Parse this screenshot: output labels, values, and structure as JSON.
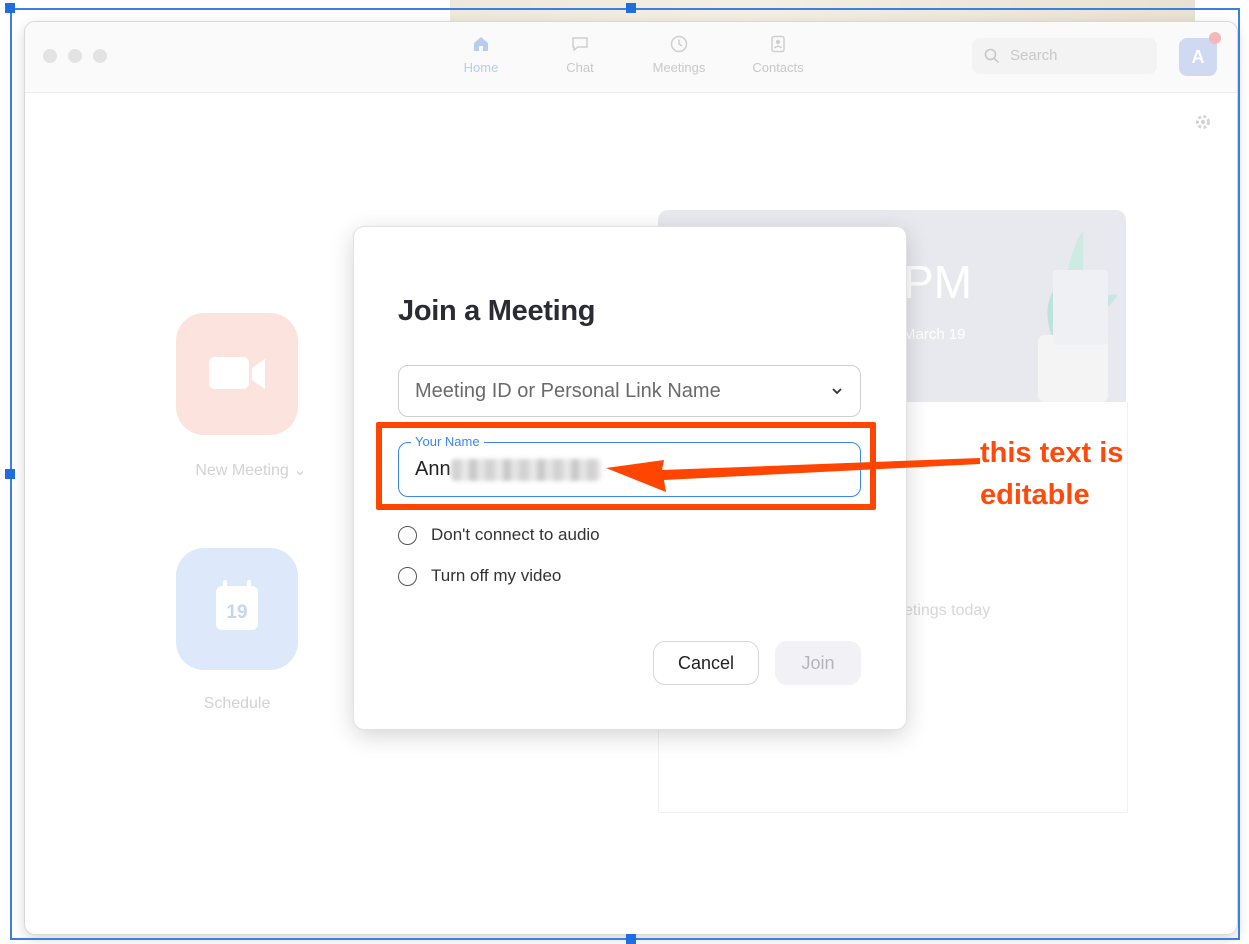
{
  "app": {
    "nav": [
      {
        "label": "Home",
        "icon": "home-icon",
        "active": true
      },
      {
        "label": "Chat",
        "icon": "chat-icon",
        "active": false
      },
      {
        "label": "Meetings",
        "icon": "clock-icon",
        "active": false
      },
      {
        "label": "Contacts",
        "icon": "contacts-icon",
        "active": false
      }
    ],
    "search": {
      "placeholder": "Search"
    },
    "avatar": {
      "initial": "A"
    }
  },
  "home": {
    "new_meeting": {
      "label": "New Meeting",
      "caret": "⌄"
    },
    "schedule": {
      "label": "Schedule",
      "day": "19"
    },
    "card": {
      "time_partial": "PM",
      "date_partial": "March 19",
      "empty_partial": "etings today"
    }
  },
  "dialog": {
    "title": "Join a Meeting",
    "meeting_id": {
      "placeholder": "Meeting ID or Personal Link Name"
    },
    "name_field": {
      "label": "Your Name",
      "value": "Ann"
    },
    "options": [
      {
        "label": "Don't connect to audio",
        "checked": false
      },
      {
        "label": "Turn off my video",
        "checked": false
      }
    ],
    "buttons": {
      "cancel": "Cancel",
      "join": "Join"
    }
  },
  "annotation": {
    "callout_line1": "this text is",
    "callout_line2": "editable",
    "color": "#ff4500"
  },
  "colors": {
    "accent_blue": "#3a86f2",
    "annotation_orange": "#ff4500"
  }
}
